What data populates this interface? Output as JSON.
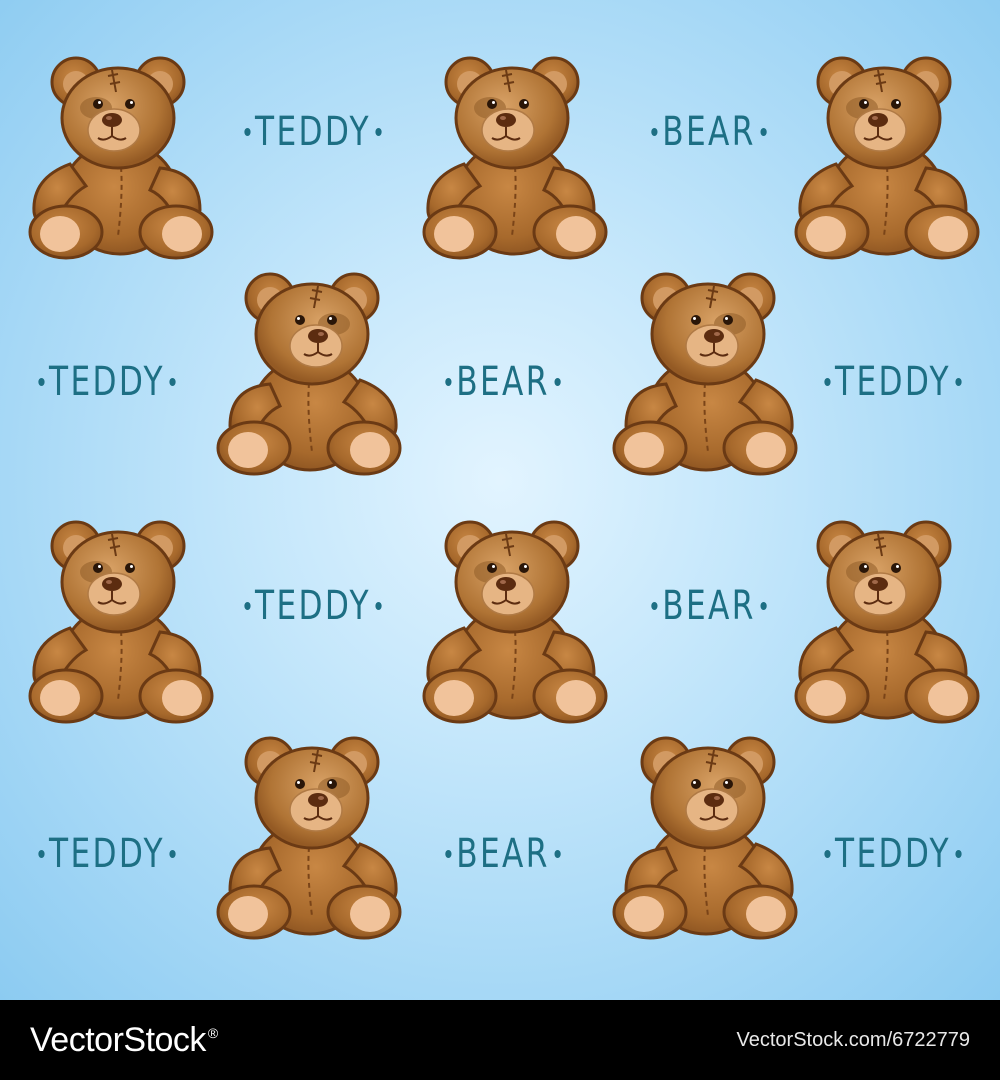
{
  "pattern": {
    "background_colors": [
      "#e2f4ff",
      "#a6d8f6",
      "#8ccbf1"
    ],
    "text_color": "#1d6f84",
    "bear_colors": {
      "fur": "#a7692c",
      "outline": "#6b3a14",
      "muzzle": "#e6b584",
      "paw_pad": "#f1c39b"
    },
    "words": [
      "TEDDY",
      "BEAR",
      "TEDDY",
      "BEAR",
      "TEDDY",
      "TEDDY",
      "BEAR",
      "TEDDY",
      "BEAR",
      "TEDDY"
    ],
    "bear_icon": "teddy-bear-icon"
  },
  "footer": {
    "brand": "VectorStock",
    "brand_mark": "®",
    "url": "VectorStock.com/6722779"
  }
}
